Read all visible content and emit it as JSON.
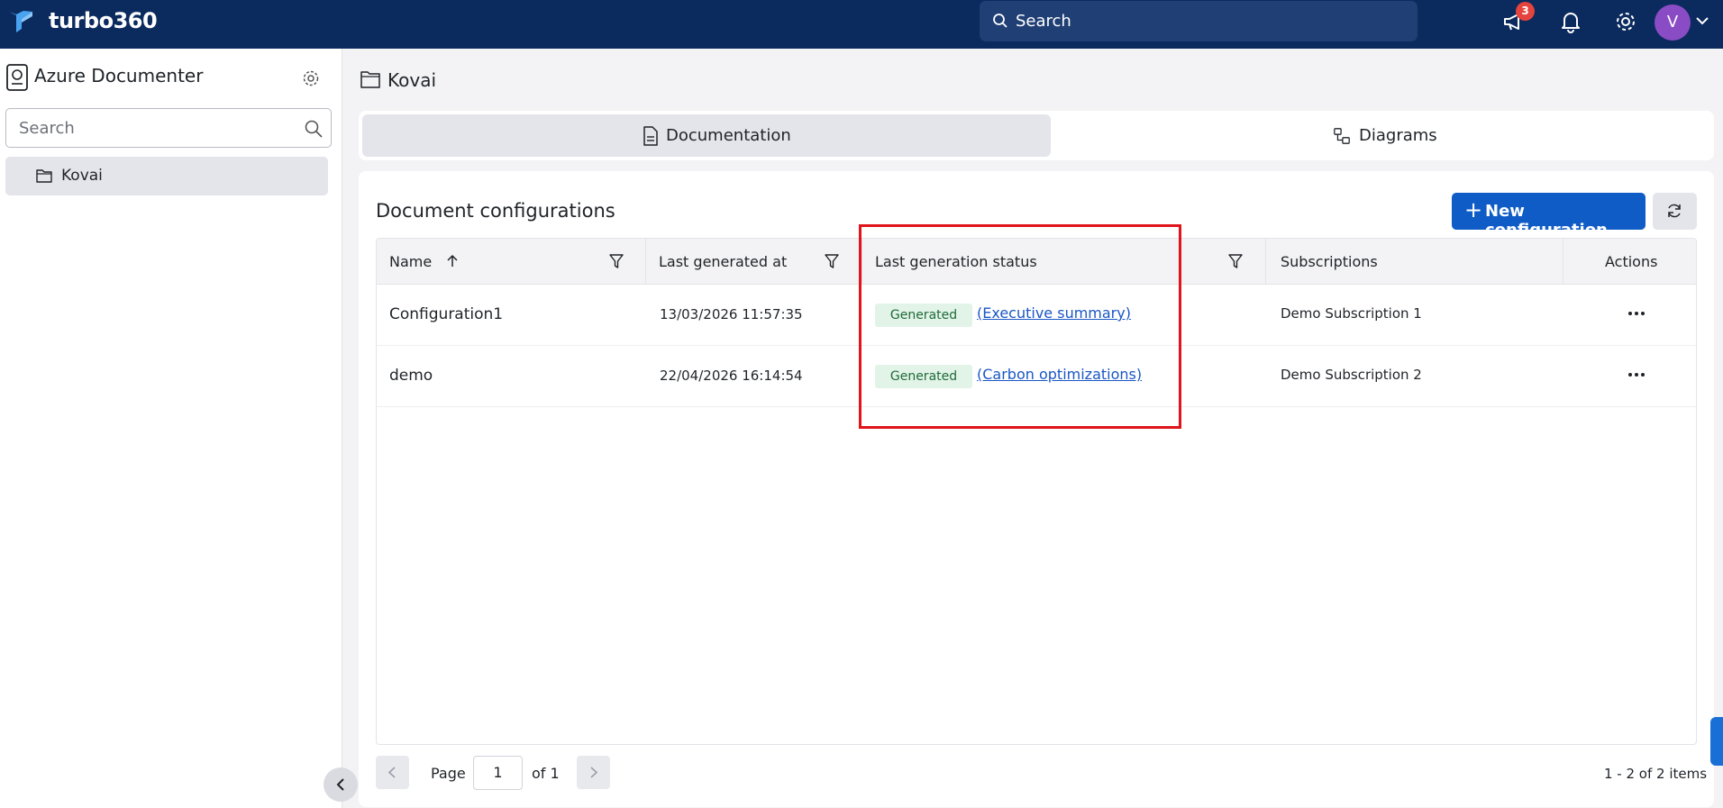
{
  "topbar": {
    "brand": "turbo360",
    "search_placeholder": "Search",
    "notification_count": "3",
    "avatar_initial": "V"
  },
  "sidebar": {
    "app_title": "Azure Documenter",
    "search_placeholder": "Search",
    "items": [
      {
        "label": "Kovai"
      }
    ]
  },
  "main": {
    "title": "Kovai",
    "tabs": [
      {
        "label": "Documentation",
        "active": true
      },
      {
        "label": "Diagrams",
        "active": false
      }
    ],
    "card_title": "Document configurations",
    "new_button_label": "New configuration",
    "table": {
      "columns": [
        "Name",
        "Last generated at",
        "Last generation status",
        "Subscriptions",
        "Actions"
      ],
      "rows": [
        {
          "name": "Configuration1",
          "last_generated": "13/03/2026 11:57:35",
          "status": "Generated",
          "report": "(Executive summary)",
          "subscription": "Demo Subscription 1"
        },
        {
          "name": "demo",
          "last_generated": "22/04/2026 16:14:54",
          "status": "Generated",
          "report": "(Carbon optimizations)",
          "subscription": "Demo Subscription 2"
        }
      ]
    },
    "pagination": {
      "page_label": "Page",
      "page_value": "1",
      "of_label": "of 1",
      "items_info": "1 - 2 of 2 items"
    }
  },
  "icons": {
    "logo": "turbo360-logo-icon",
    "search": "search-icon",
    "announcements": "megaphone-icon",
    "notifications": "bell-icon",
    "settings": "gear-icon",
    "folder": "folder-icon",
    "filter": "filter-icon",
    "sort": "arrow-up-icon",
    "more": "ellipsis-icon",
    "refresh": "refresh-icon"
  },
  "colors": {
    "topbar": "#0b2a5e",
    "primary": "#0f5cc7",
    "status_bg": "#e2f3e7",
    "status_text": "#1f6b3a",
    "link": "#1a56c4",
    "highlight": "#e0141a",
    "badge": "#e5433d",
    "avatar": "#8a4cc4"
  }
}
